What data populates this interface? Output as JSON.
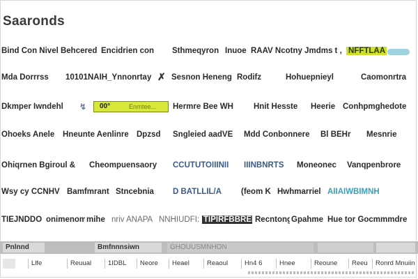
{
  "page": {
    "title": "Saaronds"
  },
  "rows": [
    {
      "cells": [
        "Bind Con Nivel Behcered",
        "Encidrien con",
        "Sthmeqyron",
        "Inuoe",
        "RAAV Ncotny Jmdms t ,",
        "NFFTLAA"
      ],
      "badge_color": "#9fd3e0"
    },
    {
      "cells": [
        "Mda Dorrrss",
        "10101NAIH_Ynnonrtay",
        "Sesnon Heneng",
        "Rodifz",
        "Hohuepnieyl",
        "Caomonrtra"
      ]
    },
    {
      "cells": [
        "Dkmper Iwndehl",
        "00°",
        "Hermre Bee WH",
        "Hnit Hesste",
        "Heerie",
        "Conhpmghedote"
      ],
      "field_value": "00°",
      "field_placeholder": "Enrntee..."
    },
    {
      "cells": [
        "Ohoeks Anele",
        "Hneunte Aenlinre",
        "Dpzsd",
        "Sngleied aadVE",
        "Mdd Conbonnere",
        "Bl BEHr",
        "Mesnrie"
      ]
    },
    {
      "cells": [
        "Ohiqrnen Bgiroul &",
        "Cheompuensaory",
        "CCUTUTOIIINII",
        "IIINBNRTS",
        "Moneonec",
        "Vanqpenbrore"
      ]
    },
    {
      "cells": [
        "Wsy cy CCNHV",
        "Bamfmrant",
        "Stncebnia",
        "D BATLLIL/A",
        "(feom K",
        "Hwhmarriel",
        "AIIAIWBIMNH"
      ]
    },
    {
      "cells": [
        "TIEJNDDO",
        "onimenom",
        "mihe",
        "nriv ANAPA",
        "NNHIUDFI:AF",
        "TIPIRFBBREB",
        "Recntong",
        "Gpahme",
        "Hue tor Gocmmmdre"
      ]
    }
  ],
  "toolbar": {
    "left": "Pnlnnd",
    "mid": "Bmfnnnsiwn",
    "ghost": "GHOUUSMNHON"
  },
  "tabs": [
    "Llfe",
    "Reuual",
    "1IDBL",
    "Neore",
    "Heael",
    "Reaoul",
    "Hn4 6",
    "Hnee",
    "Reoune",
    "Reeu",
    "Ronrd Mnuiin"
  ]
}
